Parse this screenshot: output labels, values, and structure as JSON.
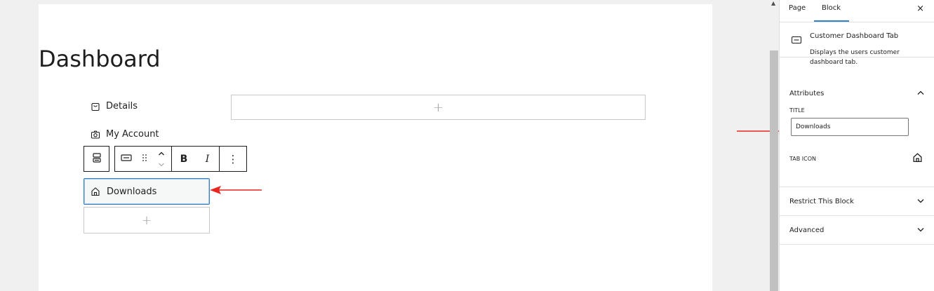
{
  "editor": {
    "page_title": "Dashboard",
    "tabs": [
      {
        "label": "Details",
        "icon": "bag-icon"
      },
      {
        "label": "My Account",
        "icon": "camera-icon"
      }
    ],
    "selected_tab": {
      "label": "Downloads",
      "icon": "home-icon"
    },
    "content_add_symbol": "+",
    "tab_add_symbol": "+",
    "toolbar": {
      "bold_label": "B",
      "italic_label": "I",
      "more_label": "⋮"
    }
  },
  "sidebar": {
    "tabs": [
      "Page",
      "Block"
    ],
    "active_tab": "Block",
    "close_label": "×",
    "block": {
      "name": "Customer Dashboard Tab",
      "description": "Displays the users customer dashboard tab."
    },
    "attributes": {
      "heading": "Attributes",
      "title_label": "TITLE",
      "title_value": "Downloads",
      "tab_icon_label": "TAB ICON"
    },
    "restrict_heading": "Restrict This Block",
    "advanced_heading": "Advanced"
  },
  "colors": {
    "accent": "#3582c4",
    "arrow": "#e8251f"
  }
}
